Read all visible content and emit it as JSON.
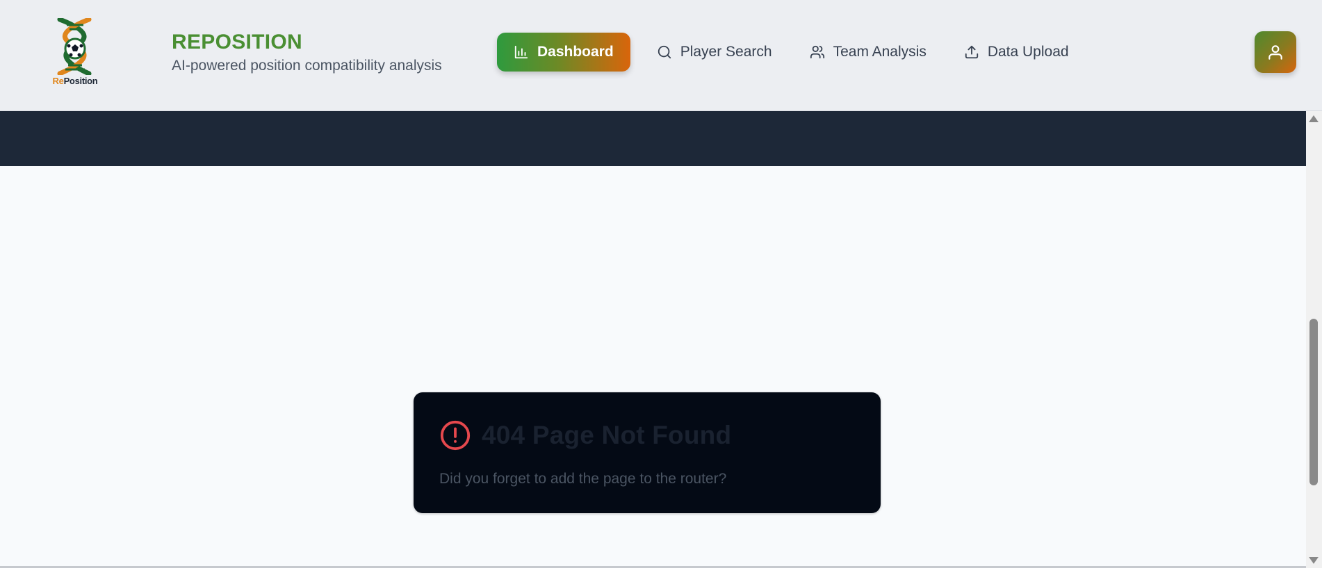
{
  "header": {
    "logo": {
      "icon": "dna-football-icon",
      "word_prefix": "Re",
      "word_suffix": "Position"
    },
    "brand": {
      "title": "REPOSITION",
      "subtitle": "AI-powered position compatibility analysis"
    },
    "nav": [
      {
        "label": "Dashboard",
        "icon": "bar-chart-icon",
        "active": true
      },
      {
        "label": "Player Search",
        "icon": "search-icon",
        "active": false
      },
      {
        "label": "Team Analysis",
        "icon": "users-icon",
        "active": false
      },
      {
        "label": "Data Upload",
        "icon": "upload-icon",
        "active": false
      }
    ],
    "user_button": {
      "icon": "user-icon"
    }
  },
  "error_card": {
    "icon": "alert-circle-icon",
    "title": "404 Page Not Found",
    "message": "Did you forget to add the page to the router?"
  },
  "colors": {
    "brand_green": "#4a8f33",
    "accent_orange": "#d9650b",
    "banner": "#1d2838",
    "card_bg": "#040a15",
    "error_red": "#e5484d"
  }
}
